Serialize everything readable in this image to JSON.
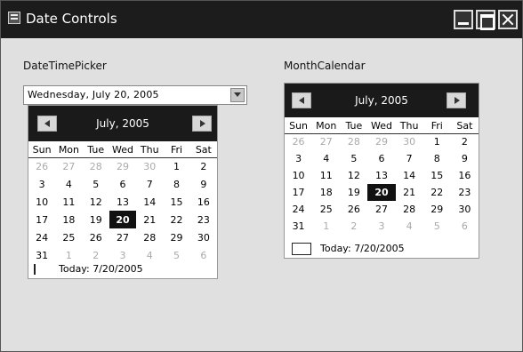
{
  "window": {
    "title": "Date Controls"
  },
  "left": {
    "label": "DateTimePicker",
    "combo_value": "Wednesday,      July      20, 2005",
    "calendar": {
      "month_label": "July, 2005",
      "days_of_week": [
        "Sun",
        "Mon",
        "Tue",
        "Wed",
        "Thu",
        "Fri",
        "Sat"
      ],
      "weeks": [
        [
          "26",
          "27",
          "28",
          "29",
          "30",
          "1",
          "2"
        ],
        [
          "3",
          "4",
          "5",
          "6",
          "7",
          "8",
          "9"
        ],
        [
          "10",
          "11",
          "12",
          "13",
          "14",
          "15",
          "16"
        ],
        [
          "17",
          "18",
          "19",
          "20",
          "21",
          "22",
          "23"
        ],
        [
          "24",
          "25",
          "26",
          "27",
          "28",
          "29",
          "30"
        ],
        [
          "31",
          "1",
          "2",
          "3",
          "4",
          "5",
          "6"
        ]
      ],
      "selected": "20",
      "today_text": "Today: 7/20/2005"
    }
  },
  "right": {
    "label": "MonthCalendar",
    "calendar": {
      "month_label": "July, 2005",
      "days_of_week": [
        "Sun",
        "Mon",
        "Tue",
        "Wed",
        "Thu",
        "Fri",
        "Sat"
      ],
      "weeks": [
        [
          "26",
          "27",
          "28",
          "29",
          "30",
          "1",
          "2"
        ],
        [
          "3",
          "4",
          "5",
          "6",
          "7",
          "8",
          "9"
        ],
        [
          "10",
          "11",
          "12",
          "13",
          "14",
          "15",
          "16"
        ],
        [
          "17",
          "18",
          "19",
          "20",
          "21",
          "22",
          "23"
        ],
        [
          "24",
          "25",
          "26",
          "27",
          "28",
          "29",
          "30"
        ],
        [
          "31",
          "1",
          "2",
          "3",
          "4",
          "5",
          "6"
        ]
      ],
      "selected": "20",
      "today_text": "Today: 7/20/2005"
    }
  },
  "colors": {
    "titlebar": "#1c1c1c",
    "window_bg": "#e0e0e0",
    "calendar_header": "#1a1a1a",
    "selection": "#111111"
  }
}
